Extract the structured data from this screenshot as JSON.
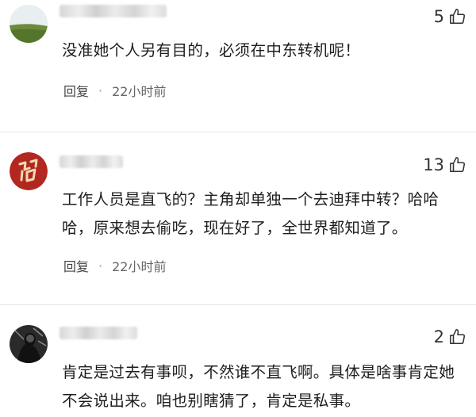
{
  "comments": [
    {
      "likes": "5",
      "text": "没准她个人另有目的，必须在中东转机呢！",
      "reply_label": "回复",
      "separator": "·",
      "time": "22小时前"
    },
    {
      "likes": "13",
      "text": "工作人员是直飞的？主角却单独一个去迪拜中转？哈哈哈，原来想去偷吃，现在好了，全世界都知道了。",
      "reply_label": "回复",
      "separator": "·",
      "time": "22小时前"
    },
    {
      "likes": "2",
      "text": "肯定是过去有事呗，不然谁不直飞啊。具体是啥事肯定她不会说出来。咱也别瞎猜了，肯定是私事。"
    }
  ],
  "icons": {
    "like": "thumbs-up-icon"
  },
  "colors": {
    "text": "#1e1e1e",
    "meta": "#666666",
    "divider": "#e5e5e5"
  }
}
